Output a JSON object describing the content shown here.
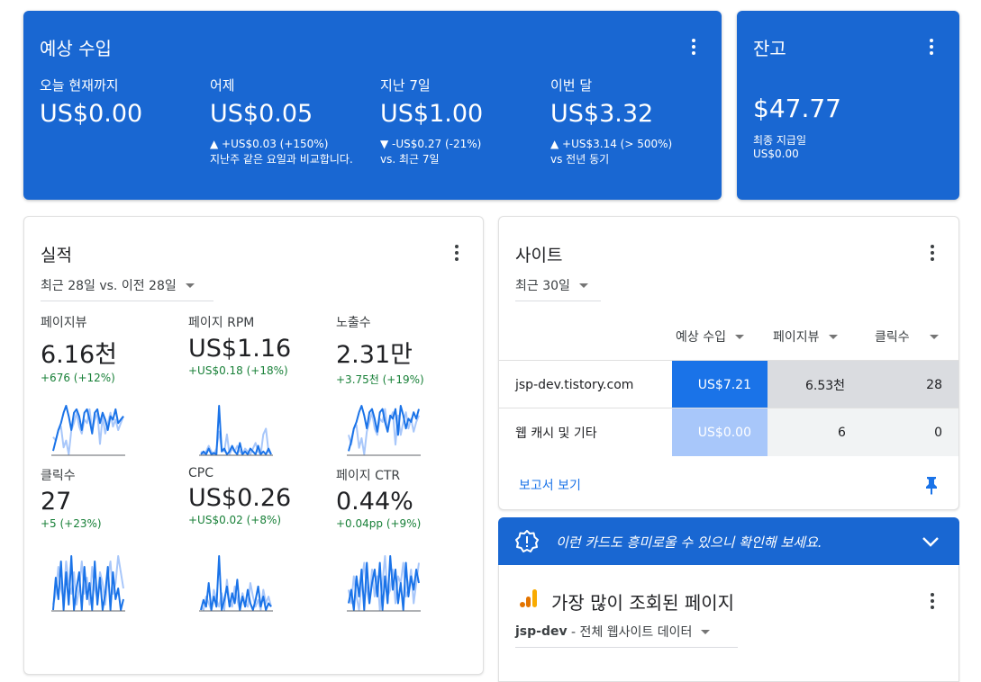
{
  "colors": {
    "accent": "#1967d2",
    "positive": "#188038",
    "spark_primary": "#1a73e8",
    "spark_secondary": "#a8c7fa",
    "bar_strong": "#1a73e8",
    "bar_light": "#a8c7fa"
  },
  "earnings": {
    "title": "예상 수입",
    "metrics": [
      {
        "label": "오늘 현재까지",
        "value": "US$0.00",
        "change": "",
        "note": ""
      },
      {
        "label": "어제",
        "value": "US$0.05",
        "change": "▲ +US$0.03 (+150%)",
        "note": "지난주 같은 요일과 비교합니다."
      },
      {
        "label": "지난 7일",
        "value": "US$1.00",
        "change": "▼ -US$0.27 (-21%)",
        "note": "vs. 최근 7일"
      },
      {
        "label": "이번 달",
        "value": "US$3.32",
        "change": "▲ +US$3.14 (> 500%)",
        "note": "vs 전년 동기"
      }
    ]
  },
  "balance": {
    "title": "잔고",
    "value": "$47.77",
    "sub1": "최종 지급일",
    "sub2": "US$0.00"
  },
  "performance": {
    "title": "실적",
    "range": "최근 28일 vs. 이전 28일",
    "metrics": [
      {
        "label": "페이지뷰",
        "value": "6.16천",
        "change": "+676 (+12%)"
      },
      {
        "label": "페이지 RPM",
        "value": "US$1.16",
        "change": "+US$0.18 (+18%)"
      },
      {
        "label": "노출수",
        "value": "2.31만",
        "change": "+3.75천 (+19%)"
      },
      {
        "label": "클릭수",
        "value": "27",
        "change": "+5 (+23%)"
      },
      {
        "label": "CPC",
        "value": "US$0.26",
        "change": "+US$0.02 (+8%)"
      },
      {
        "label": "페이지 CTR",
        "value": "0.44%",
        "change": "+0.04pp (+9%)"
      }
    ],
    "sparks": [
      {
        "current": [
          18,
          24,
          30,
          34,
          40,
          44,
          38,
          30,
          40,
          42,
          38,
          30,
          40,
          42,
          36,
          28,
          40,
          42,
          34,
          40,
          36,
          30,
          38,
          36,
          42,
          34,
          36,
          38
        ],
        "previous": [
          26,
          24,
          30,
          32,
          20,
          24,
          16,
          30,
          34,
          40,
          32,
          28,
          36,
          34,
          42,
          30,
          36,
          40,
          22,
          38,
          28,
          34,
          40,
          32,
          36,
          30,
          34,
          38
        ]
      },
      {
        "current": [
          2,
          4,
          2,
          6,
          2,
          3,
          2,
          36,
          4,
          6,
          2,
          4,
          8,
          4,
          2,
          10,
          2,
          4,
          2,
          6,
          4,
          2,
          8,
          2,
          4,
          2,
          6,
          2
        ],
        "previous": [
          4,
          2,
          4,
          8,
          4,
          2,
          6,
          18,
          6,
          4,
          16,
          2,
          6,
          4,
          8,
          4,
          2,
          6,
          4,
          2,
          6,
          10,
          4,
          2,
          16,
          20,
          4,
          2
        ]
      },
      {
        "current": [
          16,
          22,
          30,
          34,
          40,
          44,
          38,
          30,
          40,
          42,
          36,
          28,
          40,
          42,
          34,
          28,
          38,
          36,
          42,
          26,
          44,
          38,
          30,
          36,
          34,
          40,
          36,
          42
        ],
        "previous": [
          26,
          20,
          30,
          32,
          18,
          24,
          14,
          28,
          34,
          40,
          30,
          26,
          36,
          34,
          42,
          28,
          36,
          40,
          20,
          38,
          26,
          34,
          40,
          30,
          36,
          28,
          34,
          38
        ]
      },
      {
        "current": [
          0,
          30,
          10,
          45,
          0,
          35,
          5,
          50,
          0,
          20,
          35,
          0,
          40,
          10,
          25,
          0,
          45,
          5,
          30,
          0,
          15,
          40,
          0,
          35,
          10,
          20,
          0,
          10
        ],
        "previous": [
          5,
          15,
          40,
          20,
          10,
          45,
          25,
          15,
          35,
          5,
          20,
          45,
          15,
          30,
          5,
          40,
          20,
          10,
          35,
          25,
          5,
          30,
          45,
          15,
          25,
          50,
          35,
          20
        ]
      },
      {
        "current": [
          2,
          8,
          4,
          18,
          2,
          10,
          4,
          34,
          2,
          8,
          16,
          4,
          12,
          6,
          20,
          2,
          10,
          4,
          14,
          6,
          2,
          8,
          16,
          4,
          10,
          2,
          6,
          4
        ],
        "previous": [
          4,
          2,
          10,
          6,
          2,
          14,
          8,
          4,
          12,
          2,
          20,
          6,
          4,
          16,
          8,
          2,
          12,
          6,
          4,
          18,
          10,
          4,
          8,
          2,
          14,
          6,
          10,
          4
        ]
      },
      {
        "current": [
          10,
          20,
          5,
          30,
          15,
          35,
          5,
          40,
          10,
          25,
          35,
          15,
          40,
          5,
          30,
          10,
          45,
          20,
          35,
          10,
          25,
          5,
          40,
          15,
          30,
          20,
          35,
          25
        ],
        "previous": [
          20,
          10,
          30,
          15,
          5,
          25,
          40,
          20,
          10,
          35,
          15,
          30,
          5,
          25,
          45,
          15,
          20,
          35,
          10,
          30,
          25,
          40,
          15,
          20,
          35,
          10,
          25,
          40
        ]
      }
    ]
  },
  "sites": {
    "title": "사이트",
    "range": "최근 30일",
    "columns": [
      "예상 수입",
      "페이지뷰",
      "클릭수"
    ],
    "rows": [
      {
        "name": "jsp-dev.tistory.com",
        "earnings": "US$7.21",
        "pageviews": "6.53천",
        "clicks": "28",
        "earnings_fraction": 1.0
      },
      {
        "name": "웹 캐시 및 기타",
        "earnings": "US$0.00",
        "pageviews": "6",
        "clicks": "0",
        "earnings_fraction": 0.0
      }
    ],
    "report_link": "보고서 보기"
  },
  "banner": {
    "text": "이런 카드도 흥미로울 수 있으니 확인해 보세요."
  },
  "top_pages": {
    "title": "가장 많이 조회된 페이지",
    "property": "jsp-dev",
    "property_rest": " - 전체 웹사이트 데이터"
  }
}
